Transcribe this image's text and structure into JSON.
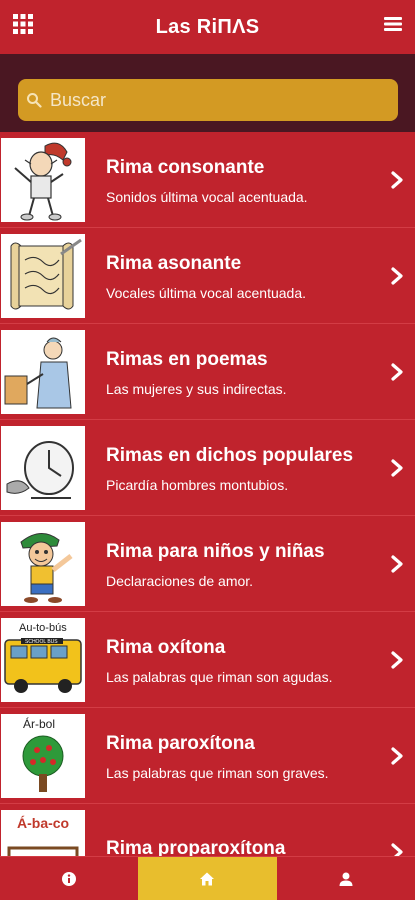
{
  "appbar": {
    "title": "Las RiΠΛS",
    "left_icon": "grid-icon",
    "right_icon": "menu-icon"
  },
  "search": {
    "placeholder": "Buscar",
    "value": "",
    "icon": "search-icon"
  },
  "items": [
    {
      "title": "Rima consonante",
      "subtitle": "Sonidos última vocal acentuada."
    },
    {
      "title": "Rima asonante",
      "subtitle": "Vocales última vocal acentuada."
    },
    {
      "title": "Rimas en poemas",
      "subtitle": "Las mujeres y sus indirectas."
    },
    {
      "title": "Rimas en dichos populares",
      "subtitle": "Picardía hombres montubios."
    },
    {
      "title": "Rima para niños y niñas",
      "subtitle": "Declaraciones de amor."
    },
    {
      "title": "Rima oxítona",
      "subtitle": "Las palabras que riman son agudas."
    },
    {
      "title": "Rima paroxítona",
      "subtitle": "Las palabras que riman son graves."
    },
    {
      "title": "Rima proparoxítona",
      "subtitle": ""
    }
  ],
  "thumb_labels": {
    "bus": "Au-to-bús",
    "school": "SCHOOL BUS",
    "tree": "Ár-bol",
    "abacus": "Á-ba-co"
  },
  "tabs": [
    {
      "icon": "info-icon",
      "active": false
    },
    {
      "icon": "home-icon",
      "active": true
    },
    {
      "icon": "user-icon",
      "active": false
    }
  ],
  "colors": {
    "primary": "#c0232d",
    "search_band": "#4a1722",
    "search_box": "#d39a23",
    "active_tab": "#e8be2d"
  }
}
